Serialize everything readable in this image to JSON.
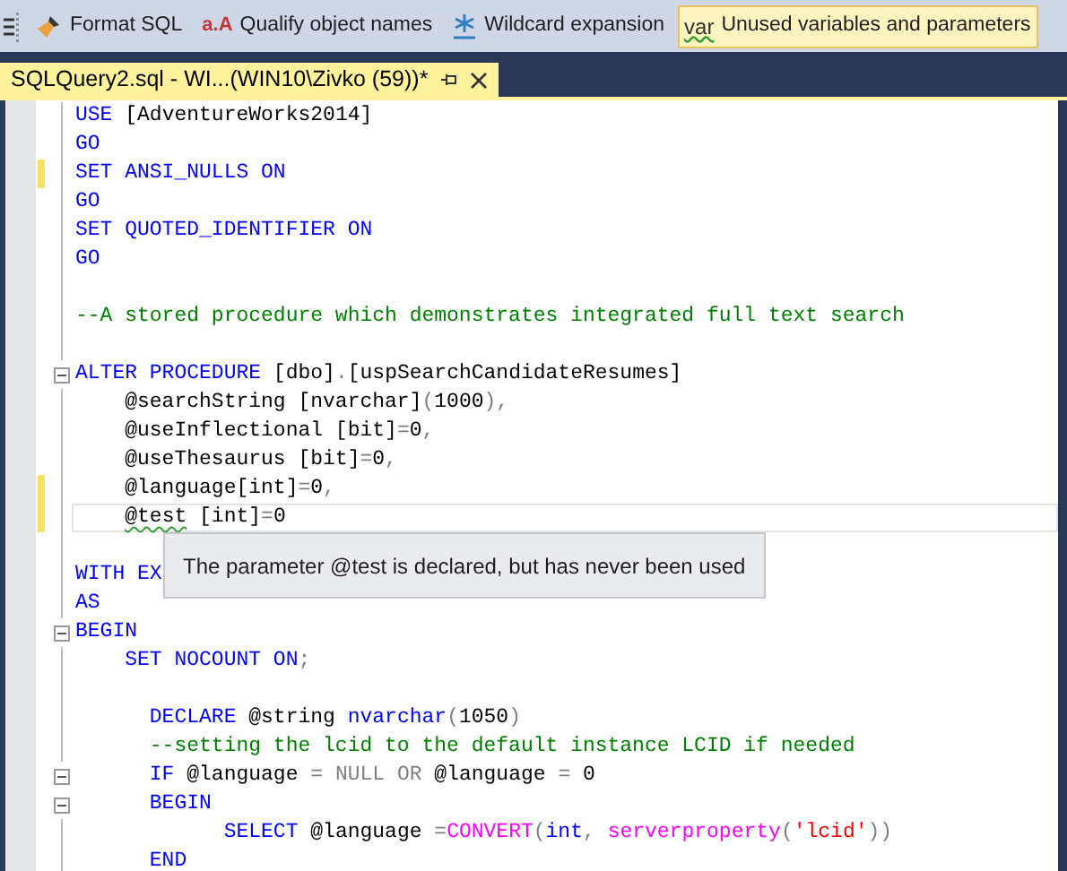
{
  "toolbar": {
    "items": [
      {
        "kind": "brush",
        "label": "Format SQL",
        "selected": false
      },
      {
        "kind": "glyph",
        "glyph": "a.A",
        "label": "Qualify object names",
        "selected": false
      },
      {
        "kind": "asterisk",
        "label": "Wildcard expansion",
        "selected": false
      },
      {
        "kind": "glyph",
        "glyph": "var",
        "label": "Unused variables and parameters",
        "selected": true
      }
    ]
  },
  "tab": {
    "title": "SQLQuery2.sql - WI...(WIN10\\Zivko (59))*",
    "selected": true
  },
  "editor": {
    "lines": [
      {
        "changed": false,
        "fold": false,
        "current": false,
        "tokens": [
          {
            "kind": "keyword",
            "text": "USE"
          },
          {
            "kind": "plain",
            "text": " [AdventureWorks2014]"
          }
        ]
      },
      {
        "changed": false,
        "fold": false,
        "current": false,
        "tokens": [
          {
            "kind": "keyword",
            "text": "GO"
          }
        ]
      },
      {
        "changed": true,
        "fold": false,
        "current": false,
        "tokens": [
          {
            "kind": "keyword",
            "text": "SET ANSI_NULLS ON"
          }
        ]
      },
      {
        "changed": false,
        "fold": false,
        "current": false,
        "tokens": [
          {
            "kind": "keyword",
            "text": "GO"
          }
        ]
      },
      {
        "changed": false,
        "fold": false,
        "current": false,
        "tokens": [
          {
            "kind": "keyword",
            "text": "SET QUOTED_IDENTIFIER ON"
          }
        ]
      },
      {
        "changed": false,
        "fold": false,
        "current": false,
        "tokens": [
          {
            "kind": "keyword",
            "text": "GO"
          }
        ]
      },
      {
        "changed": false,
        "fold": false,
        "current": false
      },
      {
        "changed": false,
        "fold": false,
        "current": false,
        "tokens": [
          {
            "kind": "comment",
            "text": "--A stored procedure which demonstrates integrated full text search"
          }
        ]
      },
      {
        "changed": false,
        "fold": false,
        "current": false
      },
      {
        "changed": false,
        "fold": true,
        "current": false,
        "tokens": [
          {
            "kind": "keyword",
            "text": "ALTER PROCEDURE"
          },
          {
            "kind": "plain",
            "text": " [dbo]"
          },
          {
            "kind": "gray",
            "text": "."
          },
          {
            "kind": "plain",
            "text": "[uspSearchCandidateResumes]"
          }
        ]
      },
      {
        "changed": false,
        "fold": false,
        "current": false,
        "tokens": [
          {
            "kind": "plain",
            "text": "    @searchString [nvarchar]"
          },
          {
            "kind": "gray",
            "text": "("
          },
          {
            "kind": "plain",
            "text": "1000"
          },
          {
            "kind": "gray",
            "text": "),"
          }
        ]
      },
      {
        "changed": false,
        "fold": false,
        "current": false,
        "tokens": [
          {
            "kind": "plain",
            "text": "    @useInflectional [bit]"
          },
          {
            "kind": "gray",
            "text": "="
          },
          {
            "kind": "plain",
            "text": "0"
          },
          {
            "kind": "gray",
            "text": ","
          }
        ]
      },
      {
        "changed": false,
        "fold": false,
        "current": false,
        "tokens": [
          {
            "kind": "plain",
            "text": "    @useThesaurus [bit]"
          },
          {
            "kind": "gray",
            "text": "="
          },
          {
            "kind": "plain",
            "text": "0"
          },
          {
            "kind": "gray",
            "text": ","
          }
        ]
      },
      {
        "changed": true,
        "fold": false,
        "current": false,
        "tokens": [
          {
            "kind": "plain",
            "text": "    @language[int]"
          },
          {
            "kind": "gray",
            "text": "="
          },
          {
            "kind": "plain",
            "text": "0"
          },
          {
            "kind": "gray",
            "text": ","
          }
        ]
      },
      {
        "changed": true,
        "fold": false,
        "current": true,
        "tokens": [
          {
            "kind": "unused",
            "text": "    @test"
          },
          {
            "kind": "plain",
            "text": " [int]"
          },
          {
            "kind": "gray",
            "text": "="
          },
          {
            "kind": "plain",
            "text": "0"
          }
        ]
      },
      {
        "changed": false,
        "fold": false,
        "current": false
      },
      {
        "changed": false,
        "fold": false,
        "current": false,
        "tokens": [
          {
            "kind": "keyword",
            "text": "WITH EX"
          }
        ]
      },
      {
        "changed": false,
        "fold": false,
        "current": false,
        "tokens": [
          {
            "kind": "keyword",
            "text": "AS"
          }
        ]
      },
      {
        "changed": false,
        "fold": true,
        "current": false,
        "tokens": [
          {
            "kind": "keyword",
            "text": "BEGIN"
          }
        ]
      },
      {
        "changed": false,
        "fold": false,
        "current": false,
        "tokens": [
          {
            "kind": "keyword",
            "text": "    SET NOCOUNT ON"
          },
          {
            "kind": "gray",
            "text": ";"
          }
        ]
      },
      {
        "changed": false,
        "fold": false,
        "current": false
      },
      {
        "changed": false,
        "fold": false,
        "current": false,
        "tokens": [
          {
            "kind": "keyword",
            "text": "      DECLARE"
          },
          {
            "kind": "plain",
            "text": " @string "
          },
          {
            "kind": "keyword",
            "text": "nvarchar"
          },
          {
            "kind": "gray",
            "text": "("
          },
          {
            "kind": "plain",
            "text": "1050"
          },
          {
            "kind": "gray",
            "text": ")"
          }
        ]
      },
      {
        "changed": false,
        "fold": false,
        "current": false,
        "tokens": [
          {
            "kind": "comment",
            "text": "      --setting the lcid to the default instance LCID if needed"
          }
        ]
      },
      {
        "changed": false,
        "fold": true,
        "current": false,
        "tokens": [
          {
            "kind": "keyword",
            "text": "      IF"
          },
          {
            "kind": "plain",
            "text": " @language "
          },
          {
            "kind": "gray",
            "text": "= NULL OR"
          },
          {
            "kind": "plain",
            "text": " @language "
          },
          {
            "kind": "gray",
            "text": "="
          },
          {
            "kind": "plain",
            "text": " 0"
          }
        ]
      },
      {
        "changed": false,
        "fold": true,
        "current": false,
        "tokens": [
          {
            "kind": "keyword",
            "text": "      BEGIN"
          }
        ]
      },
      {
        "changed": false,
        "fold": false,
        "current": false,
        "tokens": [
          {
            "kind": "keyword",
            "text": "            SELECT"
          },
          {
            "kind": "plain",
            "text": " @language "
          },
          {
            "kind": "gray",
            "text": "="
          },
          {
            "kind": "function",
            "text": "CONVERT"
          },
          {
            "kind": "gray",
            "text": "("
          },
          {
            "kind": "keyword",
            "text": "int"
          },
          {
            "kind": "gray",
            "text": ", "
          },
          {
            "kind": "function",
            "text": "serverproperty"
          },
          {
            "kind": "gray",
            "text": "("
          },
          {
            "kind": "string",
            "text": "'lcid'"
          },
          {
            "kind": "gray",
            "text": "))"
          }
        ]
      },
      {
        "changed": false,
        "fold": false,
        "current": false,
        "tokens": [
          {
            "kind": "keyword",
            "text": "      END"
          }
        ]
      }
    ],
    "tooltip": {
      "text": "The parameter @test is declared, but has never been used"
    }
  }
}
